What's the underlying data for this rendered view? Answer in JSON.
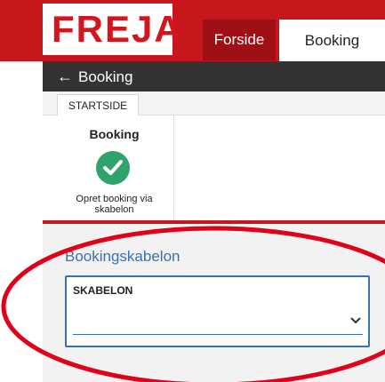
{
  "header": {
    "logo_text": "FREJA",
    "nav": [
      {
        "label": "Forside"
      },
      {
        "label": "Booking"
      }
    ]
  },
  "breadcrumb": {
    "back_arrow": "←",
    "title": "Booking"
  },
  "ribbon": {
    "tab": "STARTSIDE",
    "group_title": "Booking",
    "action_icon": "check-circle-icon",
    "action_label_line1": "Opret booking via",
    "action_label_line2": "skabelon"
  },
  "form": {
    "section_title": "Bookingskabelon",
    "field_label": "SKABELON",
    "field_value": ""
  },
  "colors": {
    "brand_red": "#c8161d",
    "dark_red": "#9e1016",
    "dark_bar": "#333333",
    "accent_blue": "#3a6fb0",
    "success_green": "#2fa36b",
    "annotation_red": "#e0001a"
  }
}
